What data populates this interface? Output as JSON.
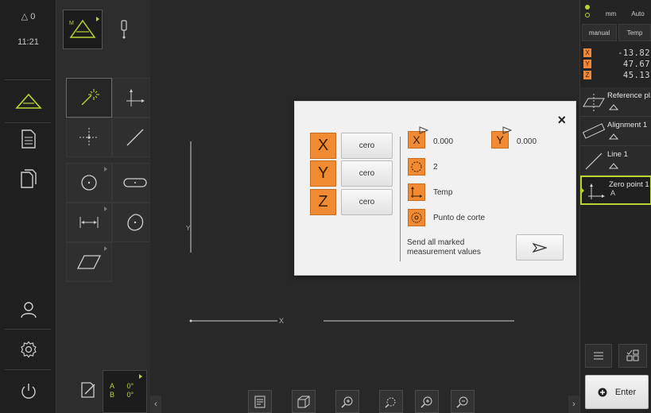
{
  "status": {
    "warnings": "△ 0",
    "time": "11:21"
  },
  "palette_status": {
    "angle_a_label": "A",
    "angle_a_value": "0°",
    "angle_b_label": "B",
    "angle_b_value": "0°"
  },
  "right_panel": {
    "units": {
      "length": "mm",
      "mode": "Auto",
      "input": "manual",
      "temp": "Temp"
    },
    "axes": [
      {
        "label": "X",
        "value": "-13.82"
      },
      {
        "label": "Y",
        "value": "47.67"
      },
      {
        "label": "Z",
        "value": "45.13"
      }
    ],
    "features": [
      {
        "name": "Reference pl."
      },
      {
        "name": "Alignment 1"
      },
      {
        "name": "Line 1"
      },
      {
        "name": "Zero point 1",
        "sub": "A"
      }
    ],
    "enter_label": "Enter"
  },
  "dialog": {
    "axes": [
      {
        "label": "X",
        "button": "cero"
      },
      {
        "label": "Y",
        "button": "cero"
      },
      {
        "label": "Z",
        "button": "cero"
      }
    ],
    "x_label": "X",
    "x_value": "0.000",
    "y_label": "Y",
    "y_value": "0.000",
    "points_count": "2",
    "coordinate_system": "Temp",
    "construction": "Punto de corte",
    "send_text_line1": "Send all marked",
    "send_text_line2": "measurement values",
    "close_icon": "×"
  },
  "canvas": {
    "axis_y": "Y",
    "axis_x": "X"
  },
  "colors": {
    "accent_orange": "#f08a33",
    "active_green": "#b9d532",
    "background": "#282828"
  }
}
